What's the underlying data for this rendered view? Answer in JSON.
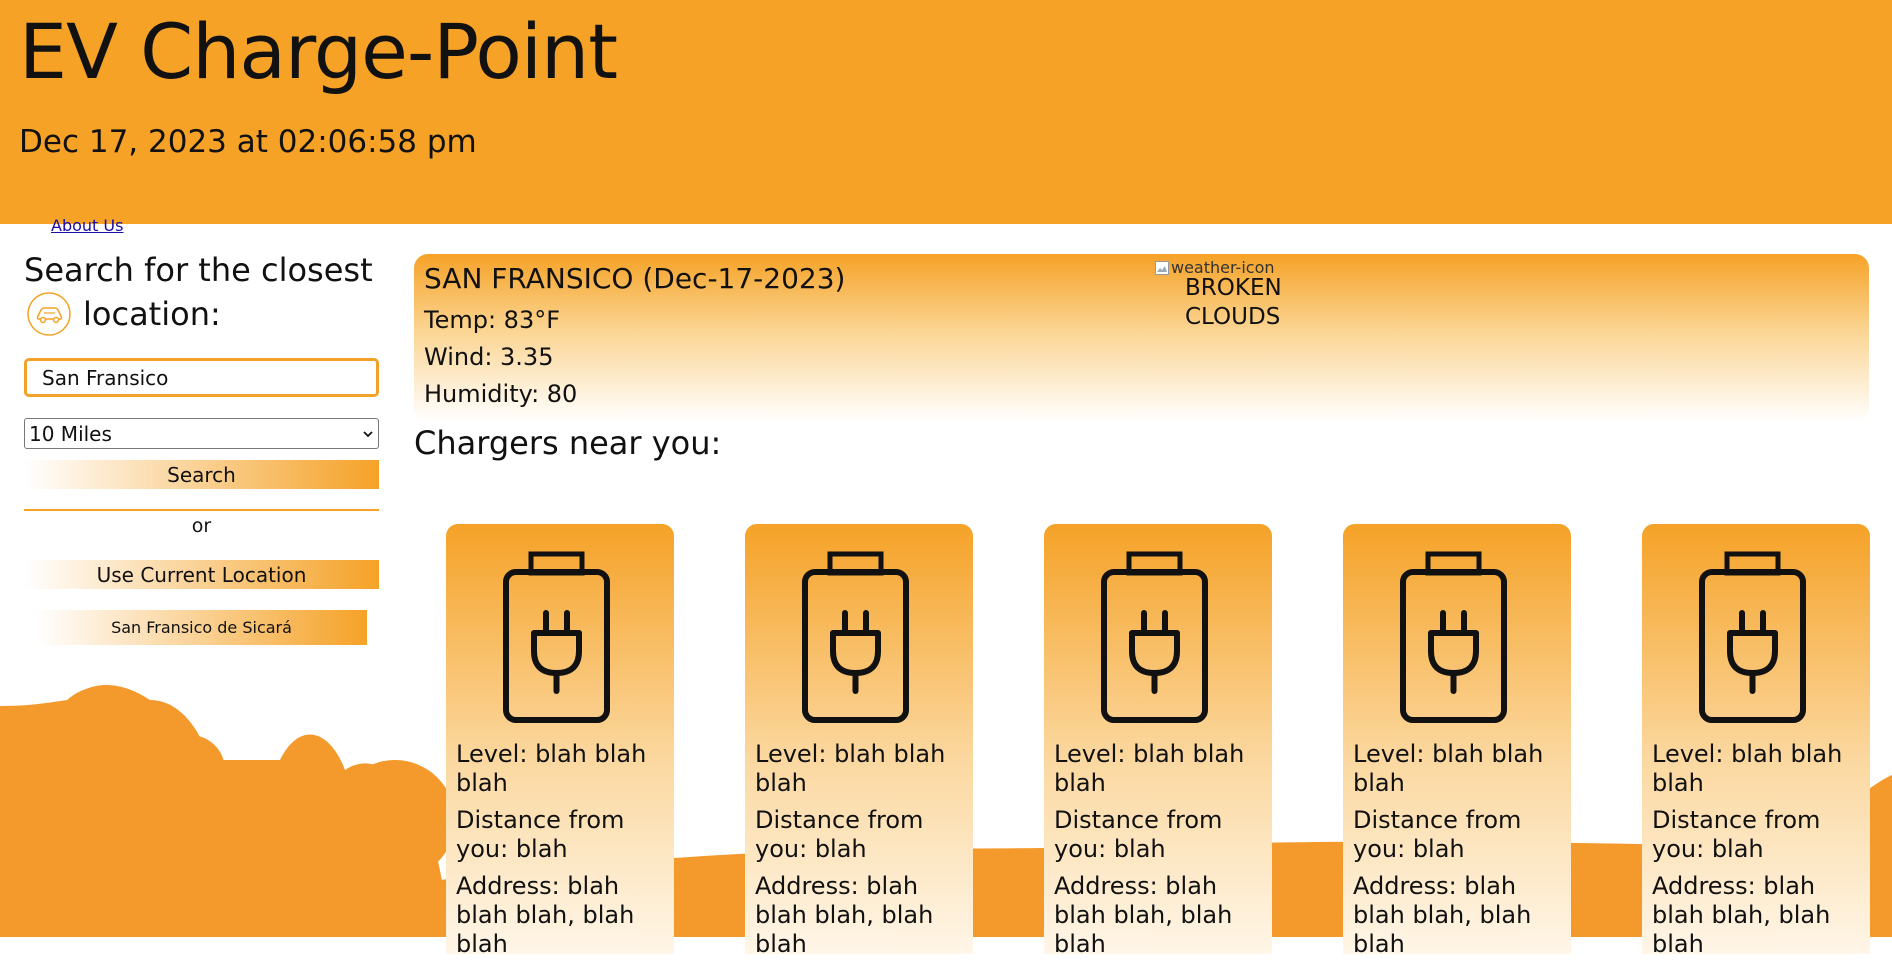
{
  "header": {
    "title": "EV Charge-Point",
    "datetime": "Dec 17, 2023 at 02:06:58 pm"
  },
  "nav": {
    "about_label": "About Us"
  },
  "search": {
    "heading_line1": "Search for the closest",
    "heading_line2": "location:",
    "city_value": "San Fransico",
    "radius_selected": "10 Miles",
    "search_label": "Search",
    "or_label": "or",
    "current_location_label": "Use Current Location",
    "suggestion_label": "San Fransico de Sicará"
  },
  "weather": {
    "city_date": "SAN FRANSICO (Dec-17-2023)",
    "temp": "Temp: 83°F",
    "wind": "Wind: 3.35",
    "humidity": "Humidity: 80",
    "icon_alt": "weather-icon",
    "description": "BROKEN CLOUDS"
  },
  "chargers": {
    "heading": "Chargers near you:",
    "items": [
      {
        "level": "Level: blah blah blah",
        "distance": "Distance from you: blah",
        "address": "Address: blah blah blah, blah blah"
      },
      {
        "level": "Level: blah blah blah",
        "distance": "Distance from you: blah",
        "address": "Address: blah blah blah, blah blah"
      },
      {
        "level": "Level: blah blah blah",
        "distance": "Distance from you: blah",
        "address": "Address: blah blah blah, blah blah"
      },
      {
        "level": "Level: blah blah blah",
        "distance": "Distance from you: blah",
        "address": "Address: blah blah blah, blah blah"
      },
      {
        "level": "Level: blah blah blah",
        "distance": "Distance from you: blah",
        "address": "Address: blah blah blah, blah blah"
      }
    ]
  },
  "colors": {
    "accent": "#f5a227",
    "hills": "#f49a2c",
    "link": "#1a0dab"
  },
  "icons": [
    "car-icon",
    "battery-plug-icon",
    "chevron-down-icon",
    "broken-image-icon"
  ]
}
